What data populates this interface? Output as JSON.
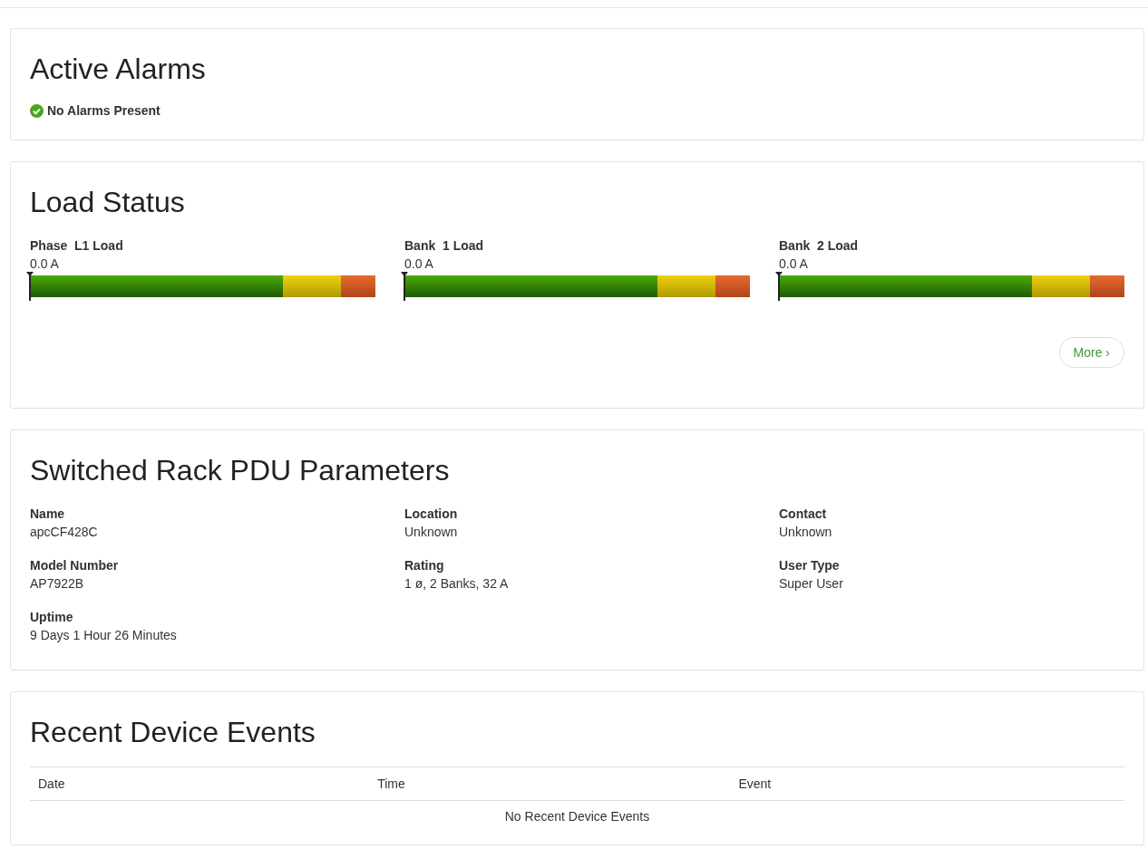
{
  "alarms": {
    "title": "Active Alarms",
    "status": "No Alarms Present",
    "ok": true
  },
  "load": {
    "title": "Load Status",
    "meters": [
      {
        "label": "Phase  L1 Load",
        "reading": "0.0 A",
        "level": 0
      },
      {
        "label": "Bank  1 Load",
        "reading": "0.0 A",
        "level": 0
      },
      {
        "label": "Bank  2 Load",
        "reading": "0.0 A",
        "level": 0
      }
    ],
    "more": "More ›"
  },
  "params": {
    "title": "Switched Rack PDU Parameters",
    "fields": [
      {
        "label": "Name",
        "value": "apcCF428C"
      },
      {
        "label": "Location",
        "value": "Unknown"
      },
      {
        "label": "Contact",
        "value": "Unknown"
      },
      {
        "label": "Model Number",
        "value": "AP7922B"
      },
      {
        "label": "Rating",
        "value": "1 ø, 2 Banks, 32 A"
      },
      {
        "label": "User Type",
        "value": "Super User"
      },
      {
        "label": "Uptime",
        "value": "9 Days 1 Hour 26 Minutes"
      }
    ]
  },
  "events": {
    "title": "Recent Device Events",
    "columns": [
      "Date",
      "Time",
      "Event"
    ],
    "empty": "No Recent Device Events"
  }
}
